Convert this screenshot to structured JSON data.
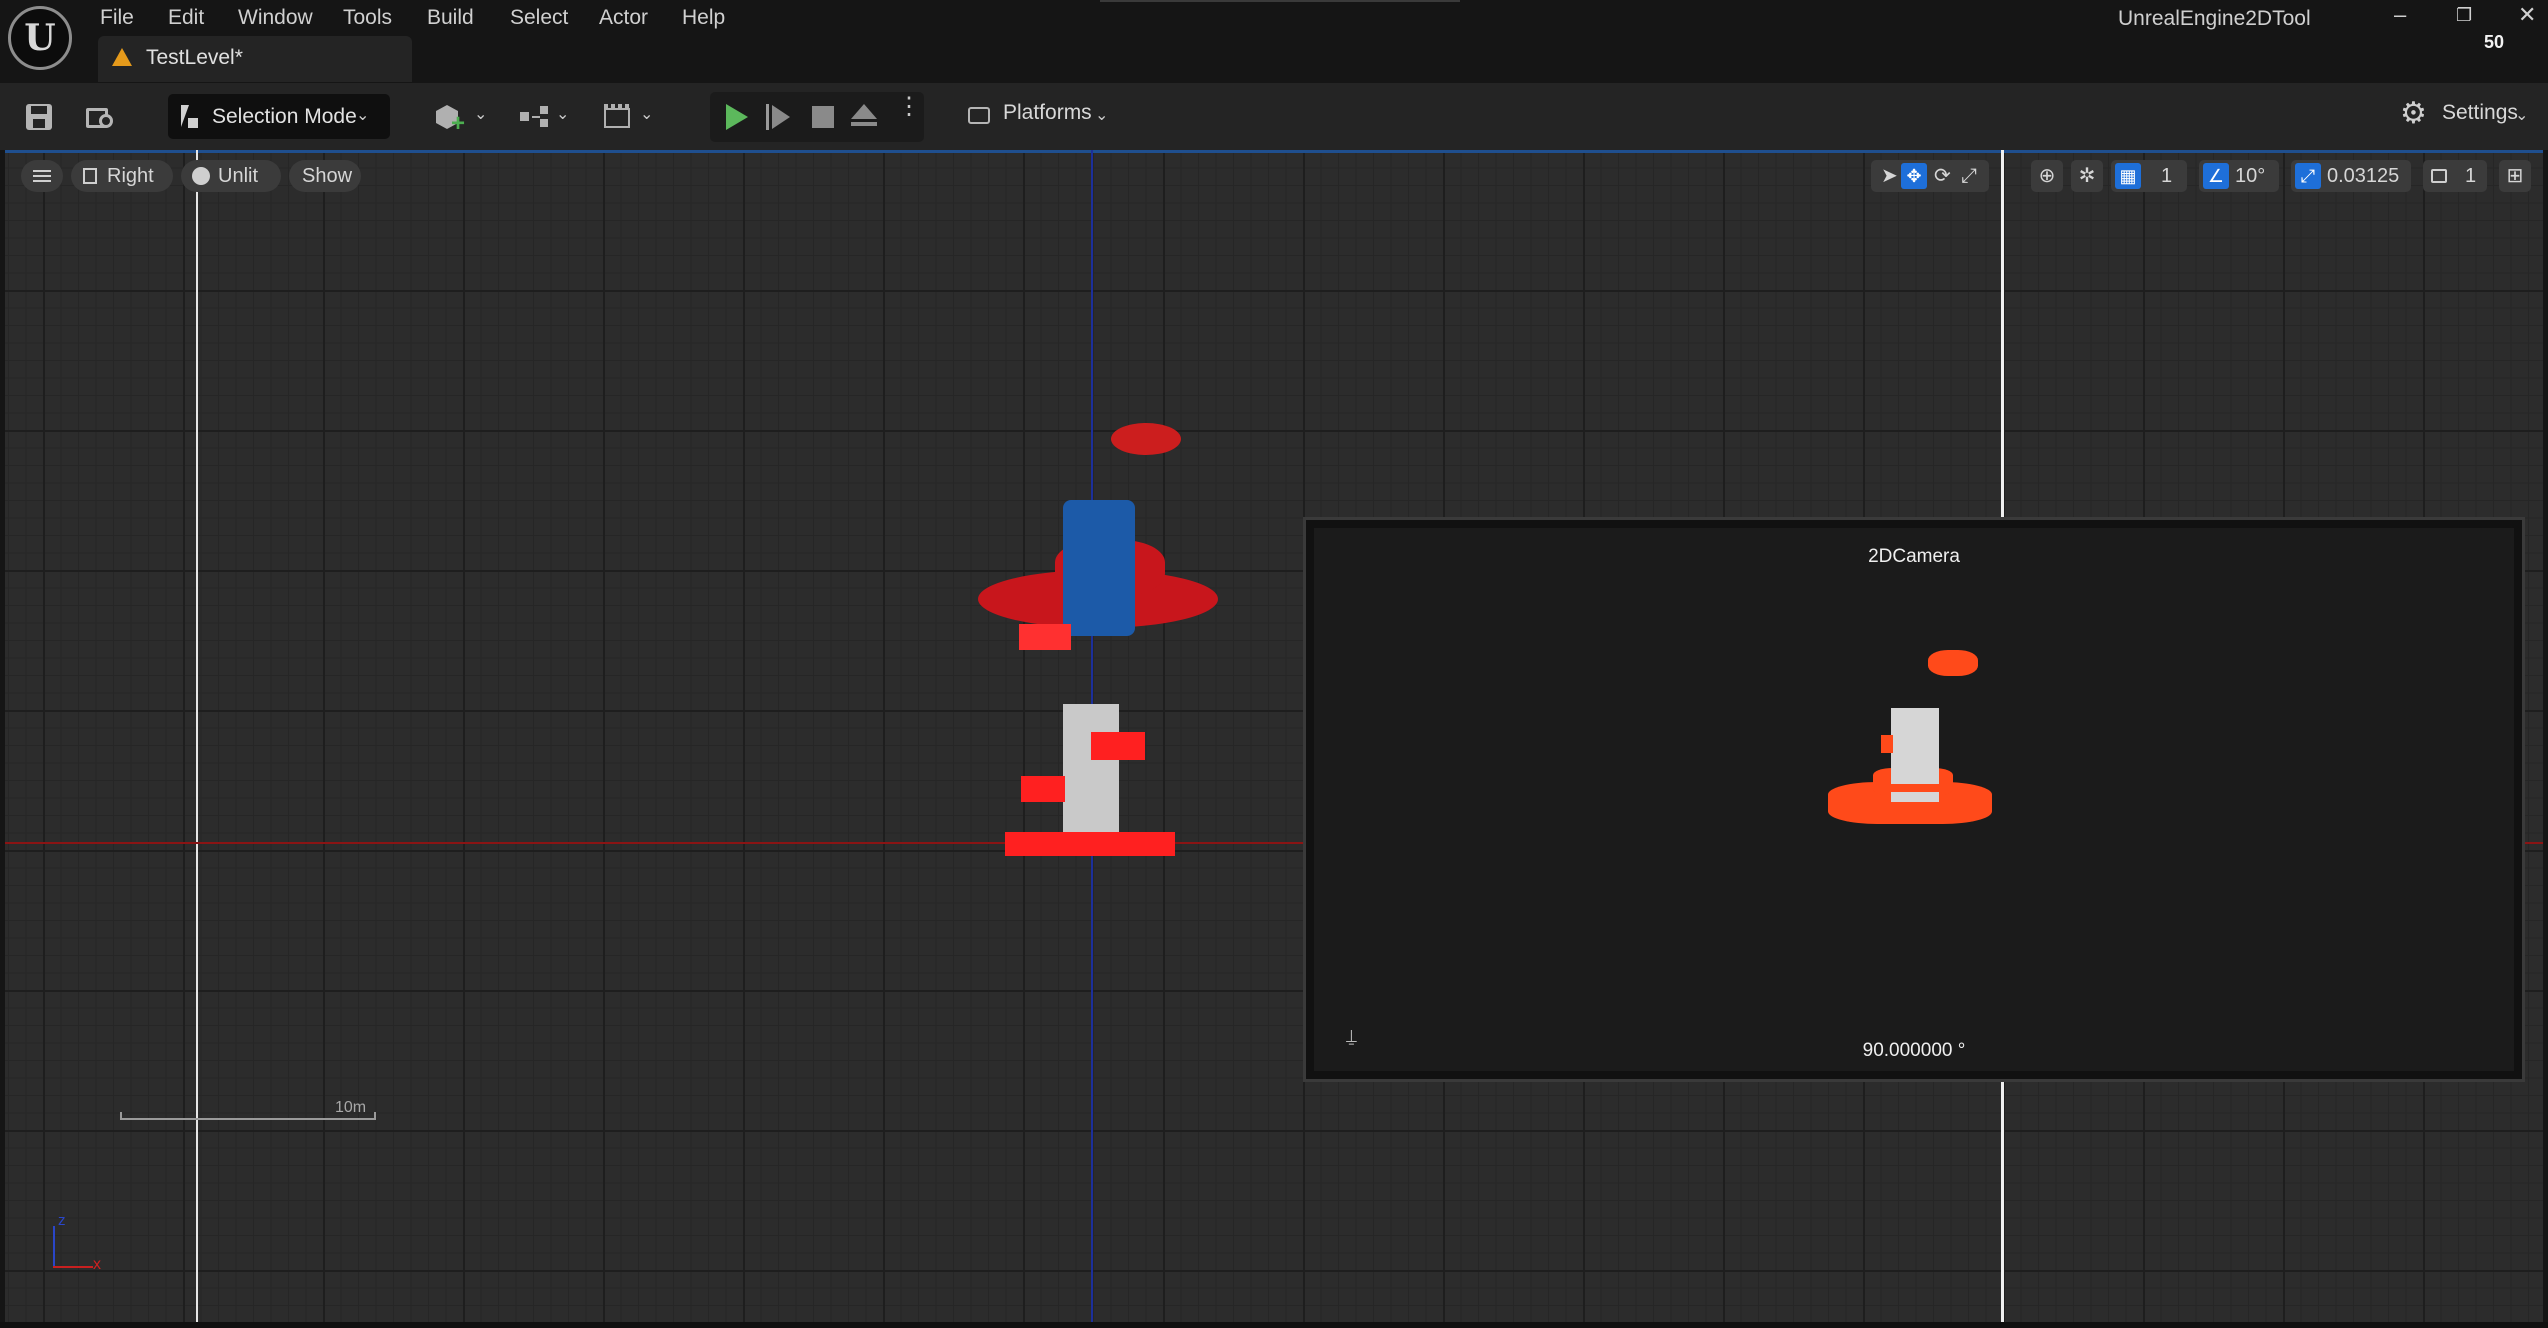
{
  "app": {
    "title": "UnrealEngine2DTool",
    "fps": "50",
    "logo_icon": "unreal-logo-icon"
  },
  "menu": [
    "File",
    "Edit",
    "Window",
    "Tools",
    "Build",
    "Select",
    "Actor",
    "Help"
  ],
  "document_tab": {
    "label": "TestLevel*",
    "icon": "warning-icon"
  },
  "window_controls": {
    "minimize": "–",
    "restore": "❐",
    "close": "✕"
  },
  "toolbar": {
    "selection_mode": "Selection Mode",
    "platforms": "Platforms",
    "settings": "Settings",
    "play_color": "#5cb85c"
  },
  "viewport": {
    "view_mode": "Right",
    "lighting": "Unlit",
    "show": "Show",
    "grid_snap": "1",
    "rotation_snap": "10°",
    "scale_snap": "0.03125",
    "camera_speed": "1",
    "scale_bar_label": "10m",
    "axis_z": "z",
    "axis_x": "x",
    "accent_color": "#1e6fd9"
  },
  "camera_preview": {
    "title": "2DCamera",
    "angle": "90.000000 °",
    "pin_icon": "pin-icon"
  }
}
